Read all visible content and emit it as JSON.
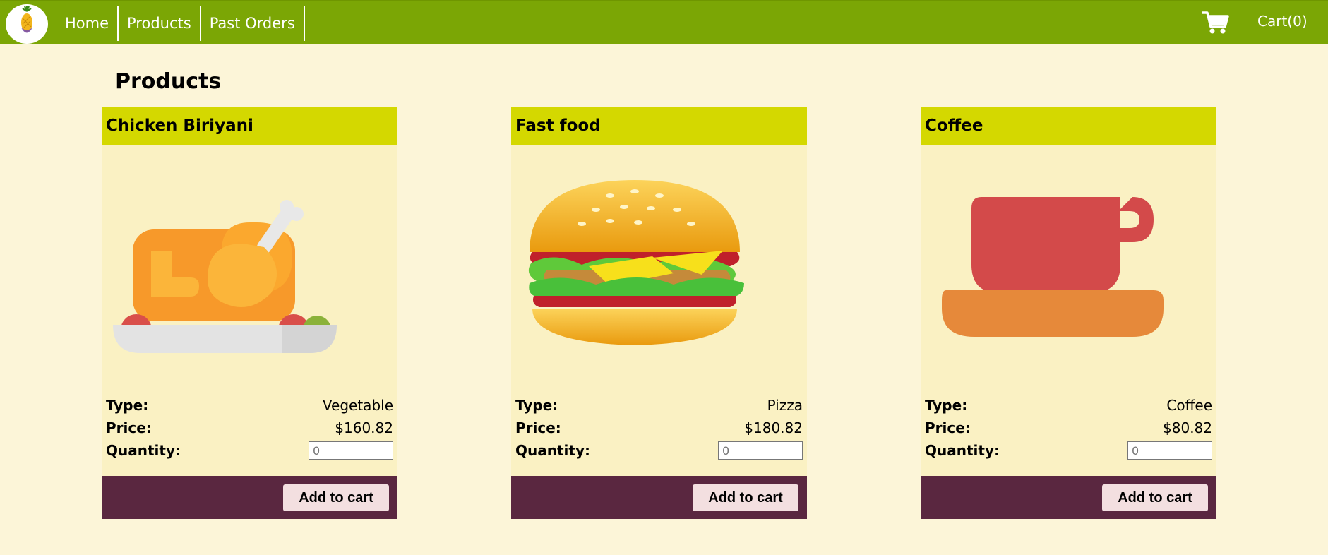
{
  "nav": {
    "links": [
      "Home",
      "Products",
      "Past Orders"
    ],
    "cart_label": "Cart(0)"
  },
  "page_title": "Products",
  "products": [
    {
      "name": "Chicken Biriyani",
      "type_label": "Type:",
      "type": "Vegetable",
      "price_label": "Price:",
      "price": "$160.82",
      "qty_label": "Quantity:",
      "qty_placeholder": "0",
      "button": "Add to cart",
      "icon": "roast-chicken-icon"
    },
    {
      "name": "Fast food",
      "type_label": "Type:",
      "type": "Pizza",
      "price_label": "Price:",
      "price": "$180.82",
      "qty_label": "Quantity:",
      "qty_placeholder": "0",
      "button": "Add to cart",
      "icon": "burger-icon"
    },
    {
      "name": "Coffee",
      "type_label": "Type:",
      "type": "Coffee",
      "price_label": "Price:",
      "price": "$80.82",
      "qty_label": "Quantity:",
      "qty_placeholder": "0",
      "button": "Add to cart",
      "icon": "coffee-cup-icon"
    }
  ],
  "colors": {
    "navbar": "#7ba605",
    "background": "#fcf5d8",
    "card_header": "#d4d800",
    "card_body": "#faf1c3",
    "card_footer": "#5a2740",
    "button": "#f3dfe0"
  }
}
